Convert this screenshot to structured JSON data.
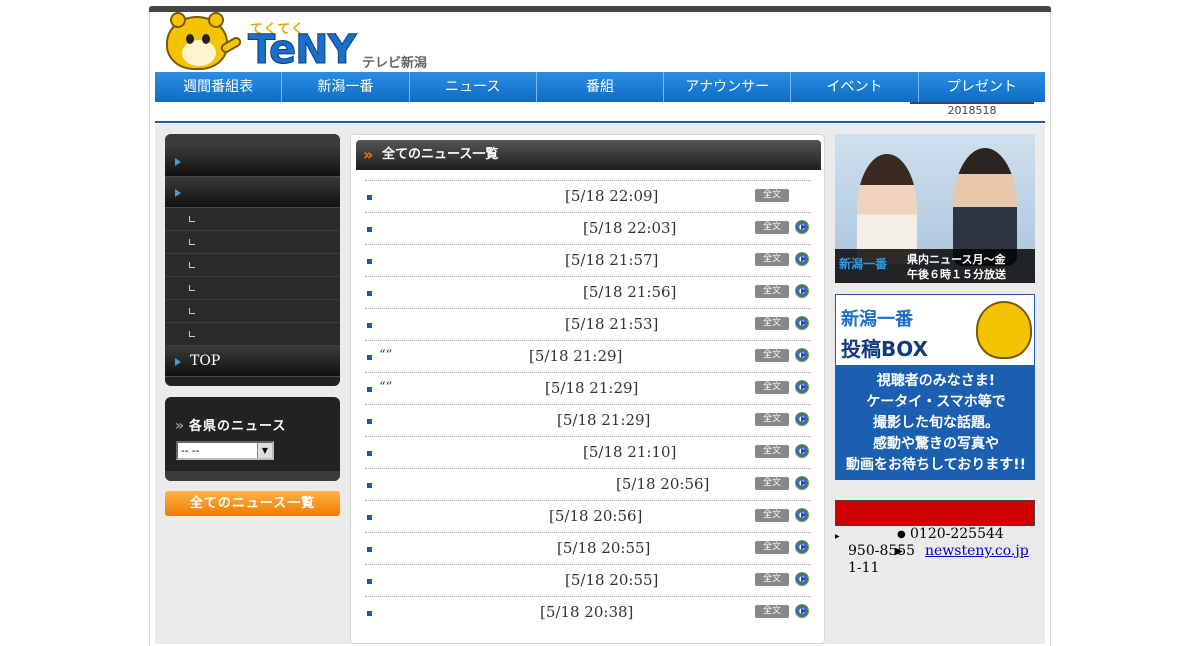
{
  "logo": {
    "small": "てくてく",
    "big": "TeNY",
    "sub": "テレビ新潟"
  },
  "nav": [
    "週間番組表",
    "新潟一番",
    "ニュース",
    "番組",
    "アナウンサー",
    "イベント",
    "プレゼント"
  ],
  "date_label": "2018518",
  "left_menu": {
    "items": [
      "",
      ""
    ],
    "subitems": [
      "",
      "",
      "",
      "",
      "",
      ""
    ],
    "top_label": "TOP"
  },
  "prefecture": {
    "title": "各県のニュース",
    "select_value": "-- --"
  },
  "all_news_button": "全てのニュース一覧",
  "center": {
    "title": "全てのニュース一覧",
    "full_label": "全文",
    "rows": [
      {
        "quote": "",
        "time": "[5/18 22:09]",
        "video": false
      },
      {
        "quote": "",
        "time": "[5/18 22:03]",
        "video": true
      },
      {
        "quote": "",
        "time": "[5/18 21:57]",
        "video": true
      },
      {
        "quote": "",
        "time": "[5/18 21:56]",
        "video": true
      },
      {
        "quote": "",
        "time": "[5/18 21:53]",
        "video": true
      },
      {
        "quote": "“”",
        "time": "[5/18 21:29]",
        "video": true
      },
      {
        "quote": "“”",
        "time": "[5/18 21:29]",
        "video": true
      },
      {
        "quote": "",
        "time": "[5/18 21:29]",
        "video": true
      },
      {
        "quote": "",
        "time": "[5/18 21:10]",
        "video": true
      },
      {
        "quote": "",
        "time": "[5/18 20:56]",
        "video": true
      },
      {
        "quote": "",
        "time": "[5/18 20:56]",
        "video": true
      },
      {
        "quote": "",
        "time": "[5/18 20:55]",
        "video": true
      },
      {
        "quote": "",
        "time": "[5/18 20:55]",
        "video": true
      },
      {
        "quote": "",
        "time": "[5/18 20:38]",
        "video": true
      }
    ]
  },
  "banner1": {
    "brand": "新潟一番",
    "line1": "県内ニュース月～金",
    "line2": "午後６時１５分放送"
  },
  "banner2": {
    "top1": "新潟一番",
    "top2": "投稿BOX",
    "body": [
      "視聴者のみなさま!",
      "ケータイ・スマホ等で",
      "撮影した旬な話題。",
      "感動や驚きの写真や",
      "動画をお待ちしております!!"
    ]
  },
  "contact": {
    "phone": "0120-225544",
    "zip": "950-8555",
    "email": "newsteny.co.jp",
    "address": "1-11"
  },
  "colors": {
    "nav_blue": "#1479d4",
    "accent_orange": "#f07a00",
    "red_bar": "#cc0000"
  }
}
